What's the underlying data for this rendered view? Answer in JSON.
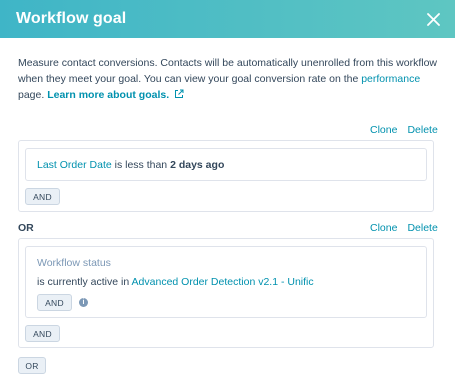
{
  "header": {
    "title": "Workflow goal",
    "close_icon": "close-icon"
  },
  "description": {
    "text": "Measure contact conversions. Contacts will be automatically unenrolled from this workflow when they meet your goal. You can view your goal conversion rate on the",
    "performance_link": "performance",
    "page_text": " page.",
    "learn_more_link": "Learn more about goals.",
    "external_icon": "external-link-icon"
  },
  "group1": {
    "clone_label": "Clone",
    "delete_label": "Delete",
    "filter": {
      "property": "Last Order Date",
      "operator": "is less than",
      "value": "2 days ago"
    },
    "and_button": "AND"
  },
  "or_separator": "OR",
  "group2": {
    "clone_label": "Clone",
    "delete_label": "Delete",
    "filter": {
      "property": "Workflow status",
      "operator": "is currently active in",
      "value": "Advanced Order Detection v2.1 - Unific"
    },
    "inner_and_button": "AND",
    "info_icon": "info-icon",
    "and_button": "AND"
  },
  "or_button": "OR"
}
